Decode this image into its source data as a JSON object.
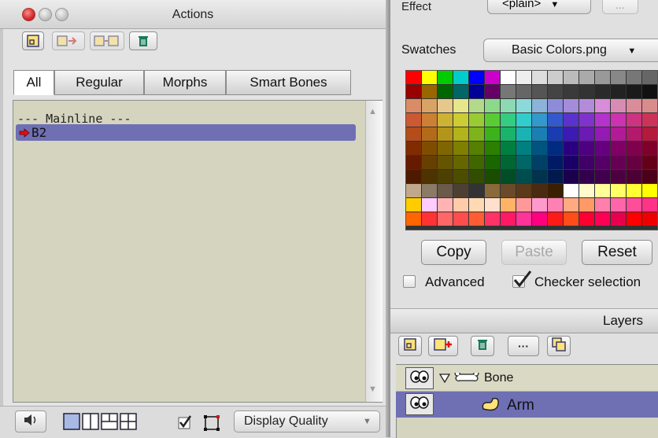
{
  "actions_panel": {
    "title": "Actions",
    "toolbar_icons": [
      "new-action-icon",
      "copy-to-action-icon",
      "merge-action-icon",
      "trash-icon"
    ],
    "tabs": [
      {
        "label": "All",
        "selected": true
      },
      {
        "label": "Regular",
        "selected": false
      },
      {
        "label": "Morphs",
        "selected": false
      },
      {
        "label": "Smart Bones",
        "selected": false
      }
    ],
    "list": {
      "header": "--- Mainline ---",
      "items": [
        {
          "label": "B2",
          "selected": true
        }
      ]
    },
    "bottom_bar": {
      "display_quality_label": "Display Quality"
    }
  },
  "style_panel": {
    "effect_label": "Effect",
    "effect_value": "<plain>",
    "effect_more_label": "...",
    "swatches_label": "Swatches",
    "swatches_value": "Basic Colors.png",
    "buttons": {
      "copy": "Copy",
      "paste": "Paste",
      "reset": "Reset"
    },
    "advanced_label": "Advanced",
    "advanced_checked": false,
    "checker_label": "Checker selection",
    "checker_checked": true
  },
  "swatch_colors": [
    [
      "#ff0000",
      "#ffff00",
      "#00cc00",
      "#00cccc",
      "#0000ff",
      "#cc00cc",
      "#ffffff",
      "#eeeeee",
      "#dddddd",
      "#cccccc",
      "#bbbbbb",
      "#aaaaaa",
      "#999999",
      "#888888",
      "#777777",
      "#666666",
      "#555555"
    ],
    [
      "#990000",
      "#996600",
      "#006600",
      "#006666",
      "#000099",
      "#660066",
      "#777777",
      "#666666",
      "#555555",
      "#444444",
      "#3a3a3a",
      "#333333",
      "#2a2a2a",
      "#222222",
      "#1a1a1a",
      "#111111",
      "#000000"
    ],
    [
      "#d98c66",
      "#d9a366",
      "#e6c88c",
      "#e6e68c",
      "#b3d98c",
      "#8cd98c",
      "#8cd9b3",
      "#8cd9d9",
      "#8cb3d9",
      "#8c8cd9",
      "#a38cd9",
      "#b38cd9",
      "#d98cd9",
      "#d98cb3",
      "#d98c99",
      "#d98c8c",
      "#d98c73"
    ],
    [
      "#cc5933",
      "#cc8033",
      "#ccb333",
      "#cccc33",
      "#99cc33",
      "#59cc33",
      "#33cc80",
      "#33cccc",
      "#3399cc",
      "#3359cc",
      "#5933cc",
      "#8033cc",
      "#b333cc",
      "#cc33b3",
      "#cc3380",
      "#cc3359",
      "#cc3333"
    ],
    [
      "#b34d1a",
      "#b36b1a",
      "#b3951a",
      "#b3b31a",
      "#7fb31a",
      "#3cb31a",
      "#1ab36b",
      "#1ab3b3",
      "#1a7fb3",
      "#1a3cb3",
      "#3c1ab3",
      "#6b1ab3",
      "#951ab3",
      "#b31a95",
      "#b31a6b",
      "#b31a3c",
      "#b31a1a"
    ],
    [
      "#802b00",
      "#804d00",
      "#806600",
      "#808000",
      "#558000",
      "#2b8000",
      "#008040",
      "#008080",
      "#005580",
      "#002b80",
      "#2b0080",
      "#4d0080",
      "#660080",
      "#800066",
      "#80004d",
      "#80002b",
      "#800000"
    ],
    [
      "#661a00",
      "#664000",
      "#665500",
      "#666600",
      "#406600",
      "#1a6600",
      "#006633",
      "#006666",
      "#004066",
      "#001a66",
      "#1a0066",
      "#400066",
      "#550066",
      "#660055",
      "#660040",
      "#66001a",
      "#660000"
    ],
    [
      "#4d1a00",
      "#4d3300",
      "#4d4000",
      "#4d4d00",
      "#334d00",
      "#1a4d00",
      "#004d26",
      "#004d4d",
      "#00334d",
      "#001a4d",
      "#1a004d",
      "#33004d",
      "#40004d",
      "#4d0040",
      "#4d0033",
      "#4d001a",
      "#4d0000"
    ],
    [
      "#c2a88a",
      "#8a7a66",
      "#6b5a4a",
      "#4d4033",
      "#333333",
      "#8a6a3a",
      "#6b4a2a",
      "#5a3a1a",
      "#4a2a10",
      "#3a2000",
      "#ffffff",
      "#fffacc",
      "#ffff99",
      "#ffff66",
      "#ffff33",
      "#ffff00",
      "#ffee00"
    ],
    [
      "#ffcc00",
      "#ffccff",
      "#ffb3b3",
      "#ffccaa",
      "#ffd9b3",
      "#ffe0cc",
      "#ffb366",
      "#ff9999",
      "#ff99cc",
      "#ff80b3",
      "#ffaa80",
      "#ff9966",
      "#ff80aa",
      "#ff66aa",
      "#ff4d99",
      "#ff3388",
      "#ff0066"
    ],
    [
      "#ff6600",
      "#ff3333",
      "#ff6666",
      "#ff4d4d",
      "#ff5c33",
      "#ff3366",
      "#ff1a66",
      "#ff3399",
      "#ff0080",
      "#ff1a1a",
      "#ff4d1a",
      "#ff0033",
      "#ff0055",
      "#e6004d",
      "#ff0000",
      "#ee0000",
      "#ffffff"
    ]
  ],
  "layers_panel": {
    "title": "Layers",
    "toolbar_icons": [
      "new-layer-icon",
      "add-layer-icon",
      "trash-icon",
      "more-icon",
      "duplicate-icon"
    ],
    "more_label": "···",
    "layers": [
      {
        "name": "Bone",
        "type": "bone",
        "expanded": true,
        "selected": false
      },
      {
        "name": "Arm",
        "type": "vector",
        "selected": true
      }
    ]
  },
  "colors": {
    "selection": "#6f6fb4",
    "list_bg": "#d4d4bf",
    "close_light": "#d22a2a"
  }
}
